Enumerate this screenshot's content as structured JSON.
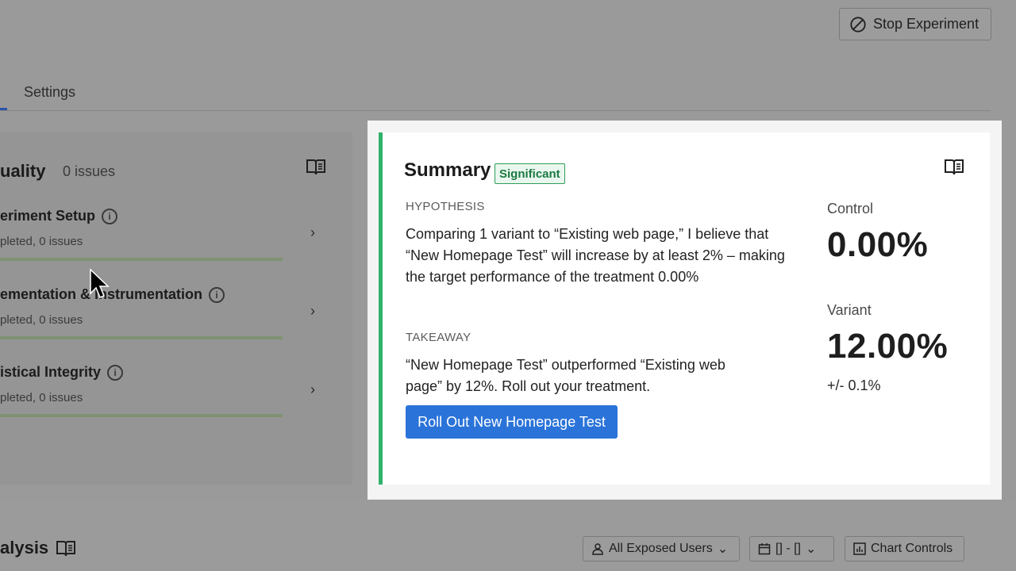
{
  "header": {
    "stop_button_label": "Stop Experiment"
  },
  "tabs": {
    "settings_label": "Settings"
  },
  "quality": {
    "title": "uality",
    "issues": "0 issues",
    "rows": [
      {
        "title": "eriment Setup",
        "sub": "pleted, 0 issues"
      },
      {
        "title": "ementation & Instrumentation",
        "sub": "pleted, 0 issues"
      },
      {
        "title": "istical Integrity",
        "sub": "pleted, 0 issues"
      }
    ]
  },
  "summary": {
    "title": "Summary",
    "badge": "Significant",
    "hypothesis_label": "HYPOTHESIS",
    "hypothesis_text": "Comparing 1 variant to “Existing web page,” I believe that “New Homepage Test” will increase by at least 2% – making the target performance of the treatment 0.00%",
    "takeaway_label": "TAKEAWAY",
    "takeaway_text": "“New Homepage Test” outperformed “Existing web page” by 12%. Roll out your treatment.",
    "rollout_button": "Roll Out New Homepage Test",
    "control_label": "Control",
    "control_value": "0.00%",
    "variant_label": "Variant",
    "variant_value": "12.00%",
    "variant_margin": "+/- 0.1%"
  },
  "analysis": {
    "title": "alysis",
    "segment_button": "All Exposed Users",
    "date_button": "[] - []",
    "chart_controls_button": "Chart Controls"
  },
  "colors": {
    "accent_green": "#2fb26b",
    "primary_blue": "#2a73d9",
    "badge_green": "#1c7a43"
  },
  "icons": [
    "ban-icon",
    "book-icon",
    "info-icon",
    "chevron-right-icon",
    "user-icon",
    "calendar-icon",
    "chevron-down-icon",
    "bar-chart-icon",
    "mouse-cursor-icon"
  ]
}
